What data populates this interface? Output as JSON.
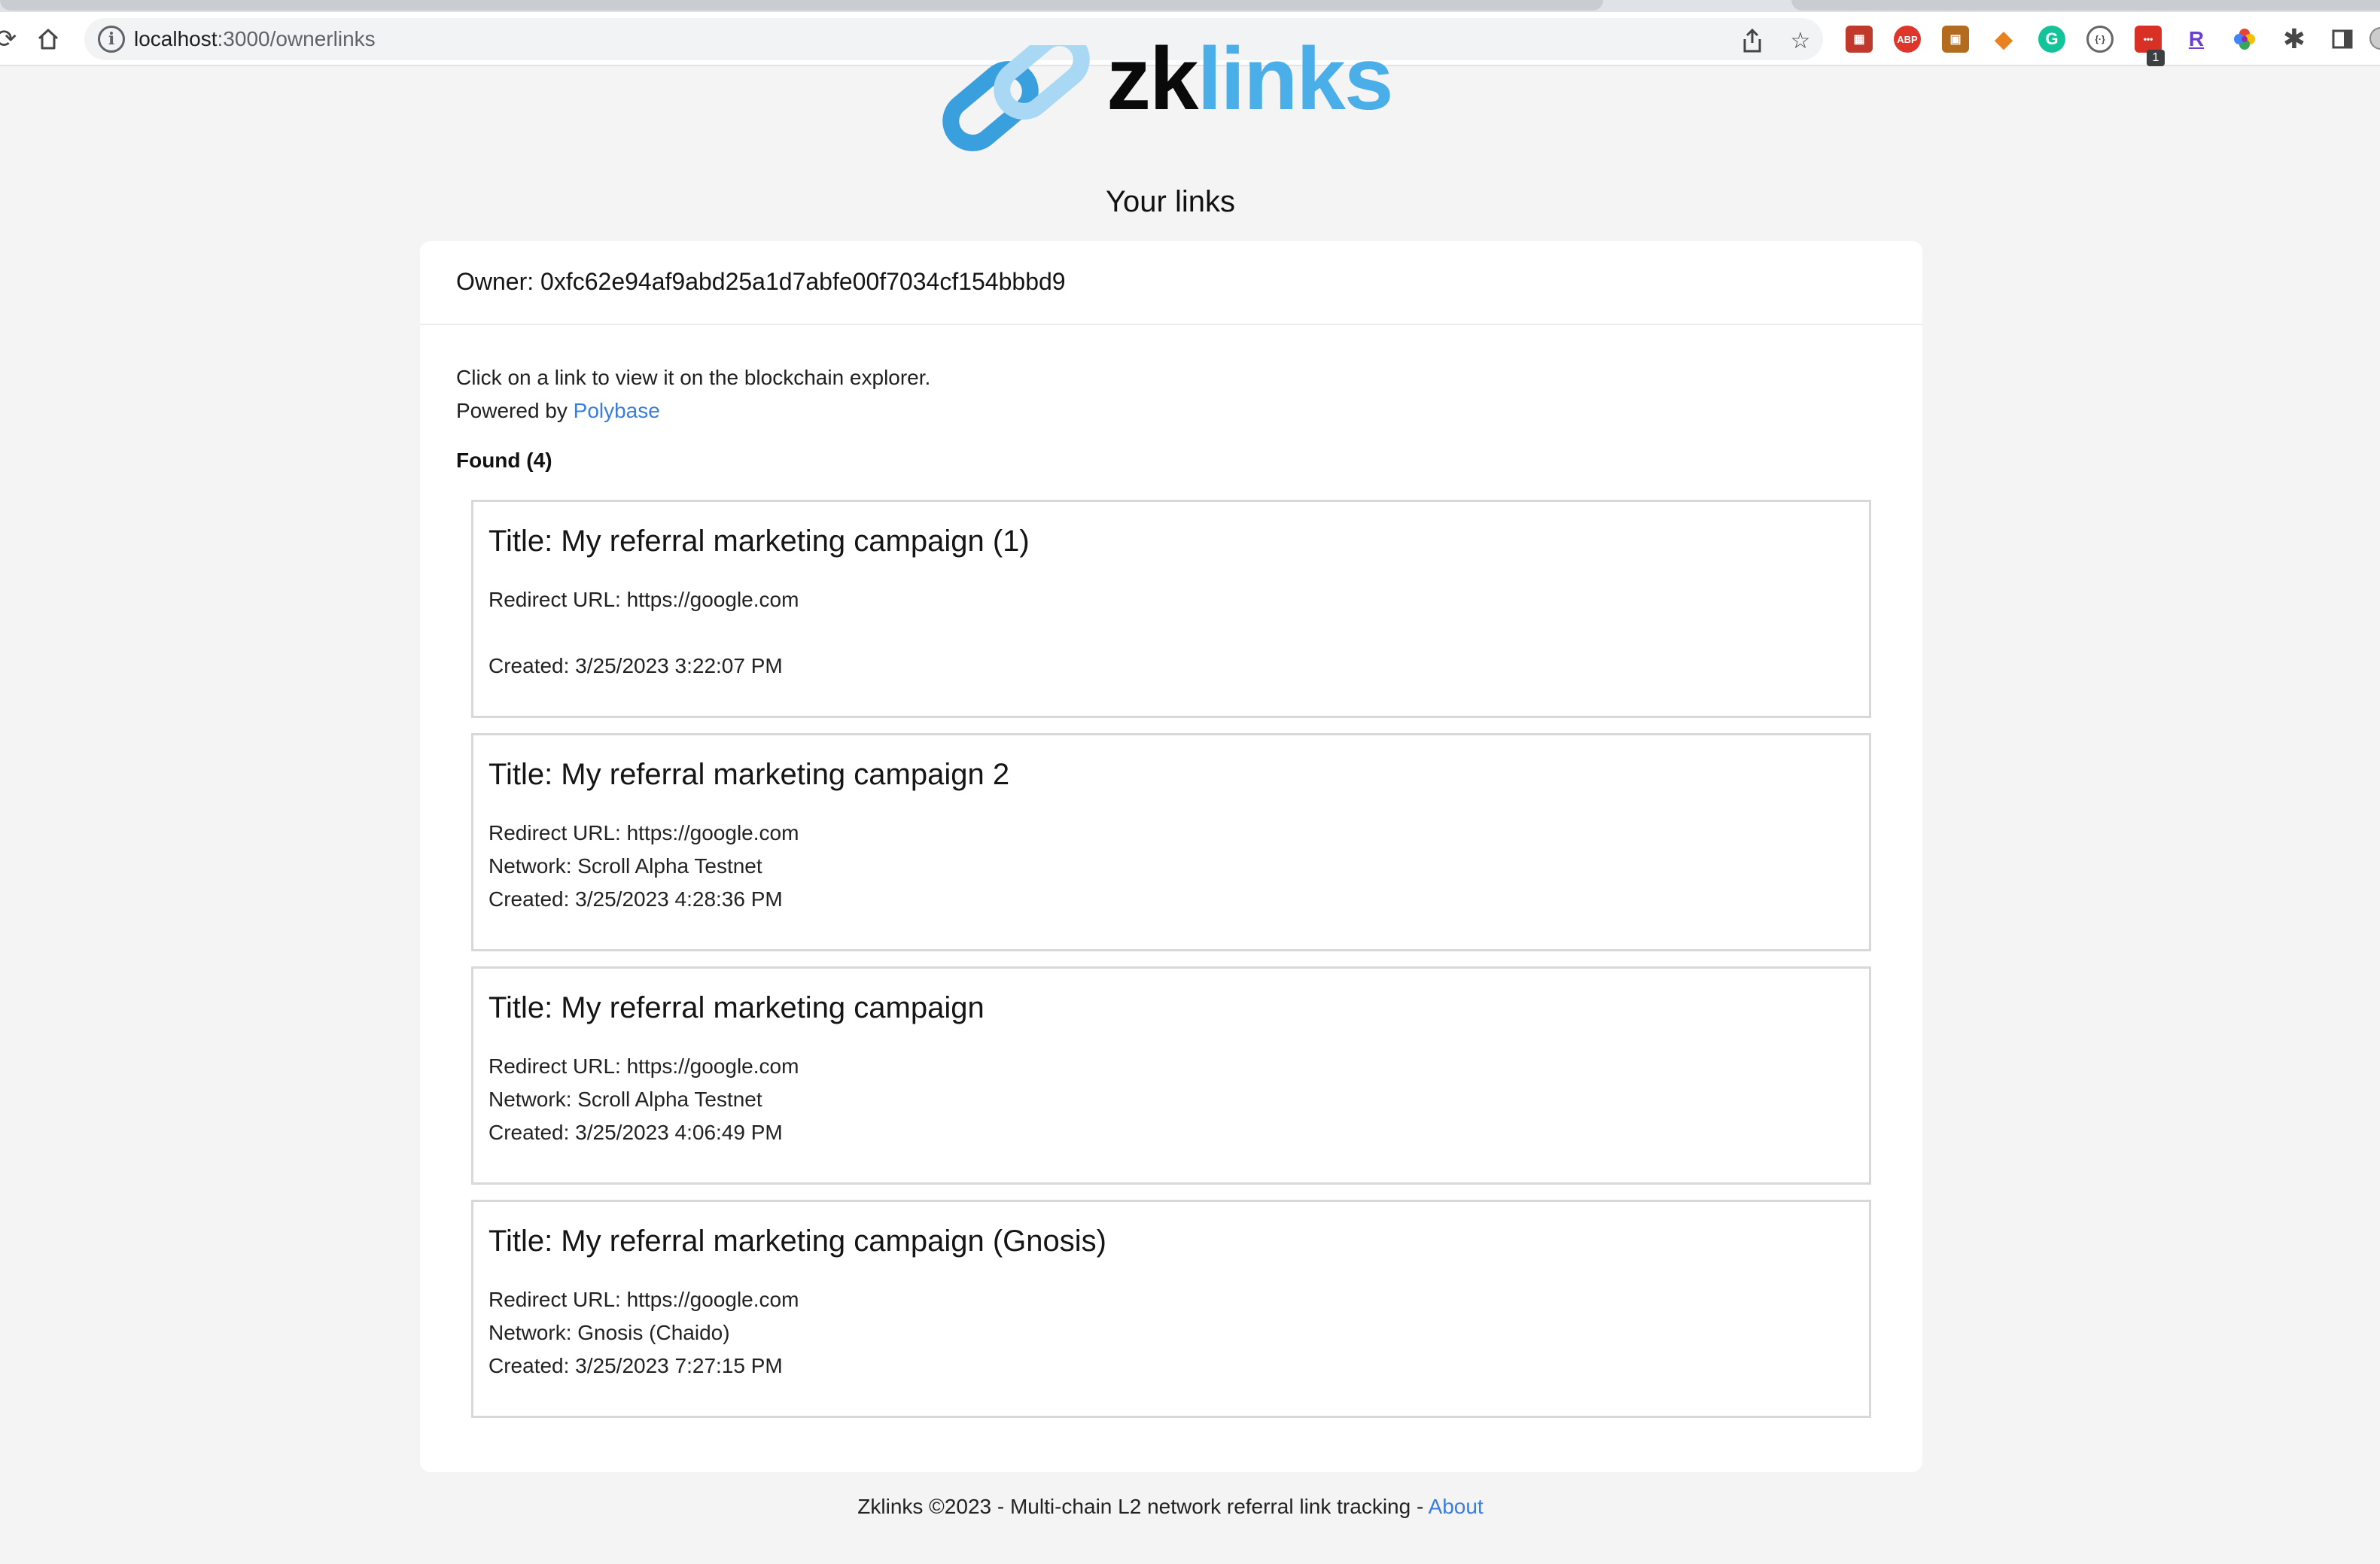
{
  "browser": {
    "url_host": "localhost",
    "url_path": ":3000/ownerlinks",
    "extensions": [
      {
        "name": "game-extension-icon",
        "color": "#c0392b",
        "glyph": "▦"
      },
      {
        "name": "adblock-plus-icon",
        "color": "#e0352b",
        "glyph": "ABP"
      },
      {
        "name": "cardboard-extension-icon",
        "color": "#b36b1e",
        "glyph": "▣"
      },
      {
        "name": "metamask-fox-icon",
        "color": "#e8821e",
        "glyph": "◆"
      },
      {
        "name": "grammarly-icon",
        "color": "#15c39a",
        "glyph": "G"
      },
      {
        "name": "code-extension-icon",
        "color": "#ffffff",
        "glyph": "{·}"
      },
      {
        "name": "todo-extension-icon",
        "color": "#d93025",
        "glyph": "•••"
      },
      {
        "name": "r-extension-icon",
        "color": "#ffffff",
        "glyph": "R"
      },
      {
        "name": "color-wheel-icon",
        "color": "#ffffff",
        "glyph": "✸"
      }
    ],
    "badge_count": "1"
  },
  "logo": {
    "text_zk": "zk",
    "text_links": "links"
  },
  "page": {
    "heading": "Your links"
  },
  "owner": {
    "label": "Owner: 0xfc62e94af9abd25a1d7abfe00f7034cf154bbbd9"
  },
  "intro": {
    "line1": "Click on a link to view it on the blockchain explorer.",
    "powered_prefix": "Powered by ",
    "powered_link": "Polybase"
  },
  "found_label": "Found (4)",
  "links": [
    {
      "title": "Title: My referral marketing campaign (1)",
      "redirect": "Redirect URL: https://google.com",
      "network": "",
      "created": "Created: 3/25/2023 3:22:07 PM"
    },
    {
      "title": "Title: My referral marketing campaign 2",
      "redirect": "Redirect URL: https://google.com",
      "network": "Network: Scroll Alpha Testnet",
      "created": "Created: 3/25/2023 4:28:36 PM"
    },
    {
      "title": "Title: My referral marketing campaign",
      "redirect": "Redirect URL: https://google.com",
      "network": "Network: Scroll Alpha Testnet",
      "created": "Created: 3/25/2023 4:06:49 PM"
    },
    {
      "title": "Title: My referral marketing campaign (Gnosis)",
      "redirect": "Redirect URL: https://google.com",
      "network": "Network: Gnosis (Chaido)",
      "created": "Created: 3/25/2023 7:27:15 PM"
    }
  ],
  "footer": {
    "text": "Zklinks ©2023 - Multi-chain L2 network referral link tracking - ",
    "about_link": "About"
  },
  "colors": {
    "accent": "#4aaee8",
    "link": "#3b7ddd",
    "background": "#f4f4f4"
  }
}
